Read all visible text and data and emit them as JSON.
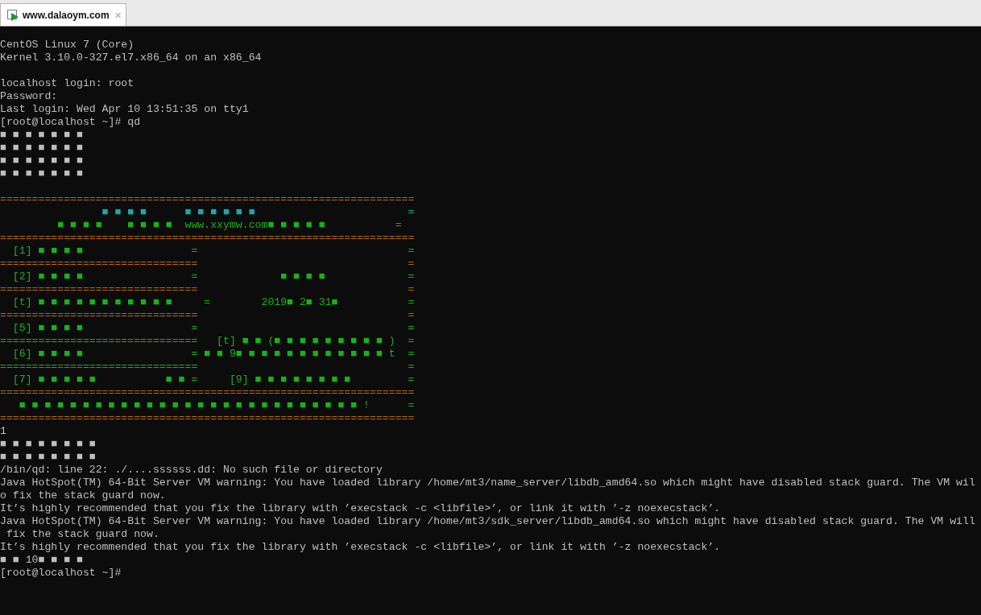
{
  "tab": {
    "title": "www.dalaoym.com",
    "close": "×",
    "selected": true
  },
  "terminal": {
    "blocks": [
      {
        "lines": [
          {
            "segments": [
              {
                "text": "CentOS Linux 7 (Core)",
                "color": "#bebebe"
              }
            ]
          },
          {
            "segments": [
              {
                "text": "Kernel 3.10.0-327.el7.x86_64 on an x86_64",
                "color": "#bebebe"
              }
            ]
          }
        ]
      },
      {
        "lines": [
          {
            "segments": [
              {
                "text": "localhost login: root",
                "color": "#bebebe"
              }
            ]
          },
          {
            "segments": [
              {
                "text": "Password:",
                "color": "#bebebe"
              }
            ]
          },
          {
            "segments": [
              {
                "text": "Last login: Wed Apr 10 13:51:35 on tty1",
                "color": "#bebebe"
              }
            ]
          },
          {
            "segments": [
              {
                "text": "[root@localhost ~]# qd",
                "color": "#bebebe"
              }
            ]
          },
          {
            "segments": [
              {
                "text": "■ ■ ■ ■ ■ ■ ■",
                "color": "#bebebe"
              }
            ]
          },
          {
            "segments": [
              {
                "text": "■ ■ ■ ■ ■ ■ ■",
                "color": "#bebebe"
              }
            ]
          },
          {
            "segments": [
              {
                "text": "■ ■ ■ ■ ■ ■ ■",
                "color": "#bebebe"
              }
            ]
          },
          {
            "segments": [
              {
                "text": "■ ■ ■ ■ ■ ■ ■",
                "color": "#bebebe"
              }
            ]
          }
        ]
      },
      {
        "lines": [
          {
            "segments": [
              {
                "text": "=================================================================",
                "color": "#b8681a"
              }
            ]
          },
          {
            "segments": [
              {
                "text": "                ■ ■ ■ ■      ■ ■ ■ ■ ■ ■                        =",
                "color": "#18aaaa"
              }
            ]
          },
          {
            "segments": [
              {
                "text": "         ■ ■ ■ ■    ■ ■ ■ ■  www.xxymw.com■ ■ ■ ■ ■           =",
                "color": "#18b218"
              }
            ]
          },
          {
            "segments": [
              {
                "text": "=================================================================",
                "color": "#b8681a"
              }
            ]
          },
          {
            "segments": [
              {
                "text": "  [1] ■ ■ ■ ■                 =                                 =",
                "color": "#18b218"
              }
            ]
          },
          {
            "segments": [
              {
                "text": "===============================                                 =",
                "color": "#b8681a"
              }
            ]
          },
          {
            "segments": [
              {
                "text": "  [2] ■ ■ ■ ■                 =             ■ ■ ■ ■             =",
                "color": "#18b218"
              }
            ]
          },
          {
            "segments": [
              {
                "text": "===============================                                 =",
                "color": "#b8681a"
              }
            ]
          },
          {
            "segments": [
              {
                "text": "  [t] ■ ■ ■ ■ ■ ■ ■ ■ ■ ■ ■     =        2019■ 2■ 31■           =",
                "color": "#18b218"
              }
            ]
          },
          {
            "segments": [
              {
                "text": "===============================                                 =",
                "color": "#b8681a"
              }
            ]
          },
          {
            "segments": [
              {
                "text": "  [5] ■ ■ ■ ■                 =                                 =",
                "color": "#18b218"
              }
            ]
          },
          {
            "segments": [
              {
                "text": "===============================   [t] ■ ■ (■ ■ ■ ■ ■ ■ ■ ■ ■ )  =",
                "color": "#18b218"
              }
            ]
          },
          {
            "segments": [
              {
                "text": "  [6] ■ ■ ■ ■                 = ■ ■ 9■ ■ ■ ■ ■ ■ ■ ■ ■ ■ ■ ■ t  =",
                "color": "#18b218"
              }
            ]
          },
          {
            "segments": [
              {
                "text": "===============================                                 =",
                "color": "#18b218"
              }
            ]
          },
          {
            "segments": [
              {
                "text": "  [7] ■ ■ ■ ■ ■           ■ ■ =     [9] ■ ■ ■ ■ ■ ■ ■ ■         =",
                "color": "#18b218"
              }
            ]
          },
          {
            "segments": [
              {
                "text": "=================================================================",
                "color": "#b8681a"
              }
            ]
          },
          {
            "segments": [
              {
                "text": "   ■ ■ ■ ■ ■ ■ ■ ■ ■ ■ ■ ■ ■ ■ ■ ■ ■ ■ ■ ■ ■ ■ ■ ■ ■ ■ ■ !      =",
                "color": "#18b218"
              }
            ]
          },
          {
            "segments": [
              {
                "text": "=================================================================",
                "color": "#b8681a"
              }
            ]
          },
          {
            "segments": [
              {
                "text": "1",
                "color": "#bebebe"
              }
            ]
          },
          {
            "segments": [
              {
                "text": "■ ■ ■ ■ ■ ■ ■ ■",
                "color": "#bebebe"
              }
            ]
          },
          {
            "segments": [
              {
                "text": "■ ■ ■ ■ ■ ■ ■ ■",
                "color": "#bebebe"
              }
            ]
          },
          {
            "segments": [
              {
                "text": "/bin/qd: line 22: ./....ssssss.dd: No such file or directory",
                "color": "#bebebe"
              }
            ]
          },
          {
            "segments": [
              {
                "text": "Java HotSpot(TM) 64-Bit Server VM warning: You have loaded library /home/mt3/name_server/libdb_amd64.so which might have disabled stack guard. The VM wil",
                "color": "#bebebe"
              }
            ]
          },
          {
            "segments": [
              {
                "text": "o fix the stack guard now.",
                "color": "#bebebe"
              }
            ]
          },
          {
            "segments": [
              {
                "text": "It’s highly recommended that you fix the library with ’execstack -c <libfile>’, or link it with ’-z noexecstack’.",
                "color": "#bebebe"
              }
            ]
          },
          {
            "segments": [
              {
                "text": "Java HotSpot(TM) 64-Bit Server VM warning: You have loaded library /home/mt3/sdk_server/libdb_amd64.so which might have disabled stack guard. The VM will",
                "color": "#bebebe"
              }
            ]
          },
          {
            "segments": [
              {
                "text": " fix the stack guard now.",
                "color": "#bebebe"
              }
            ]
          },
          {
            "segments": [
              {
                "text": "It’s highly recommended that you fix the library with ’execstack -c <libfile>’, or link it with ’-z noexecstack’.",
                "color": "#bebebe"
              }
            ]
          },
          {
            "segments": [
              {
                "text": "■ ■ 10■ ■ ■ ■",
                "color": "#bebebe"
              }
            ]
          },
          {
            "segments": [
              {
                "text": "[root@localhost ~]#",
                "color": "#bebebe"
              }
            ]
          }
        ]
      }
    ]
  }
}
